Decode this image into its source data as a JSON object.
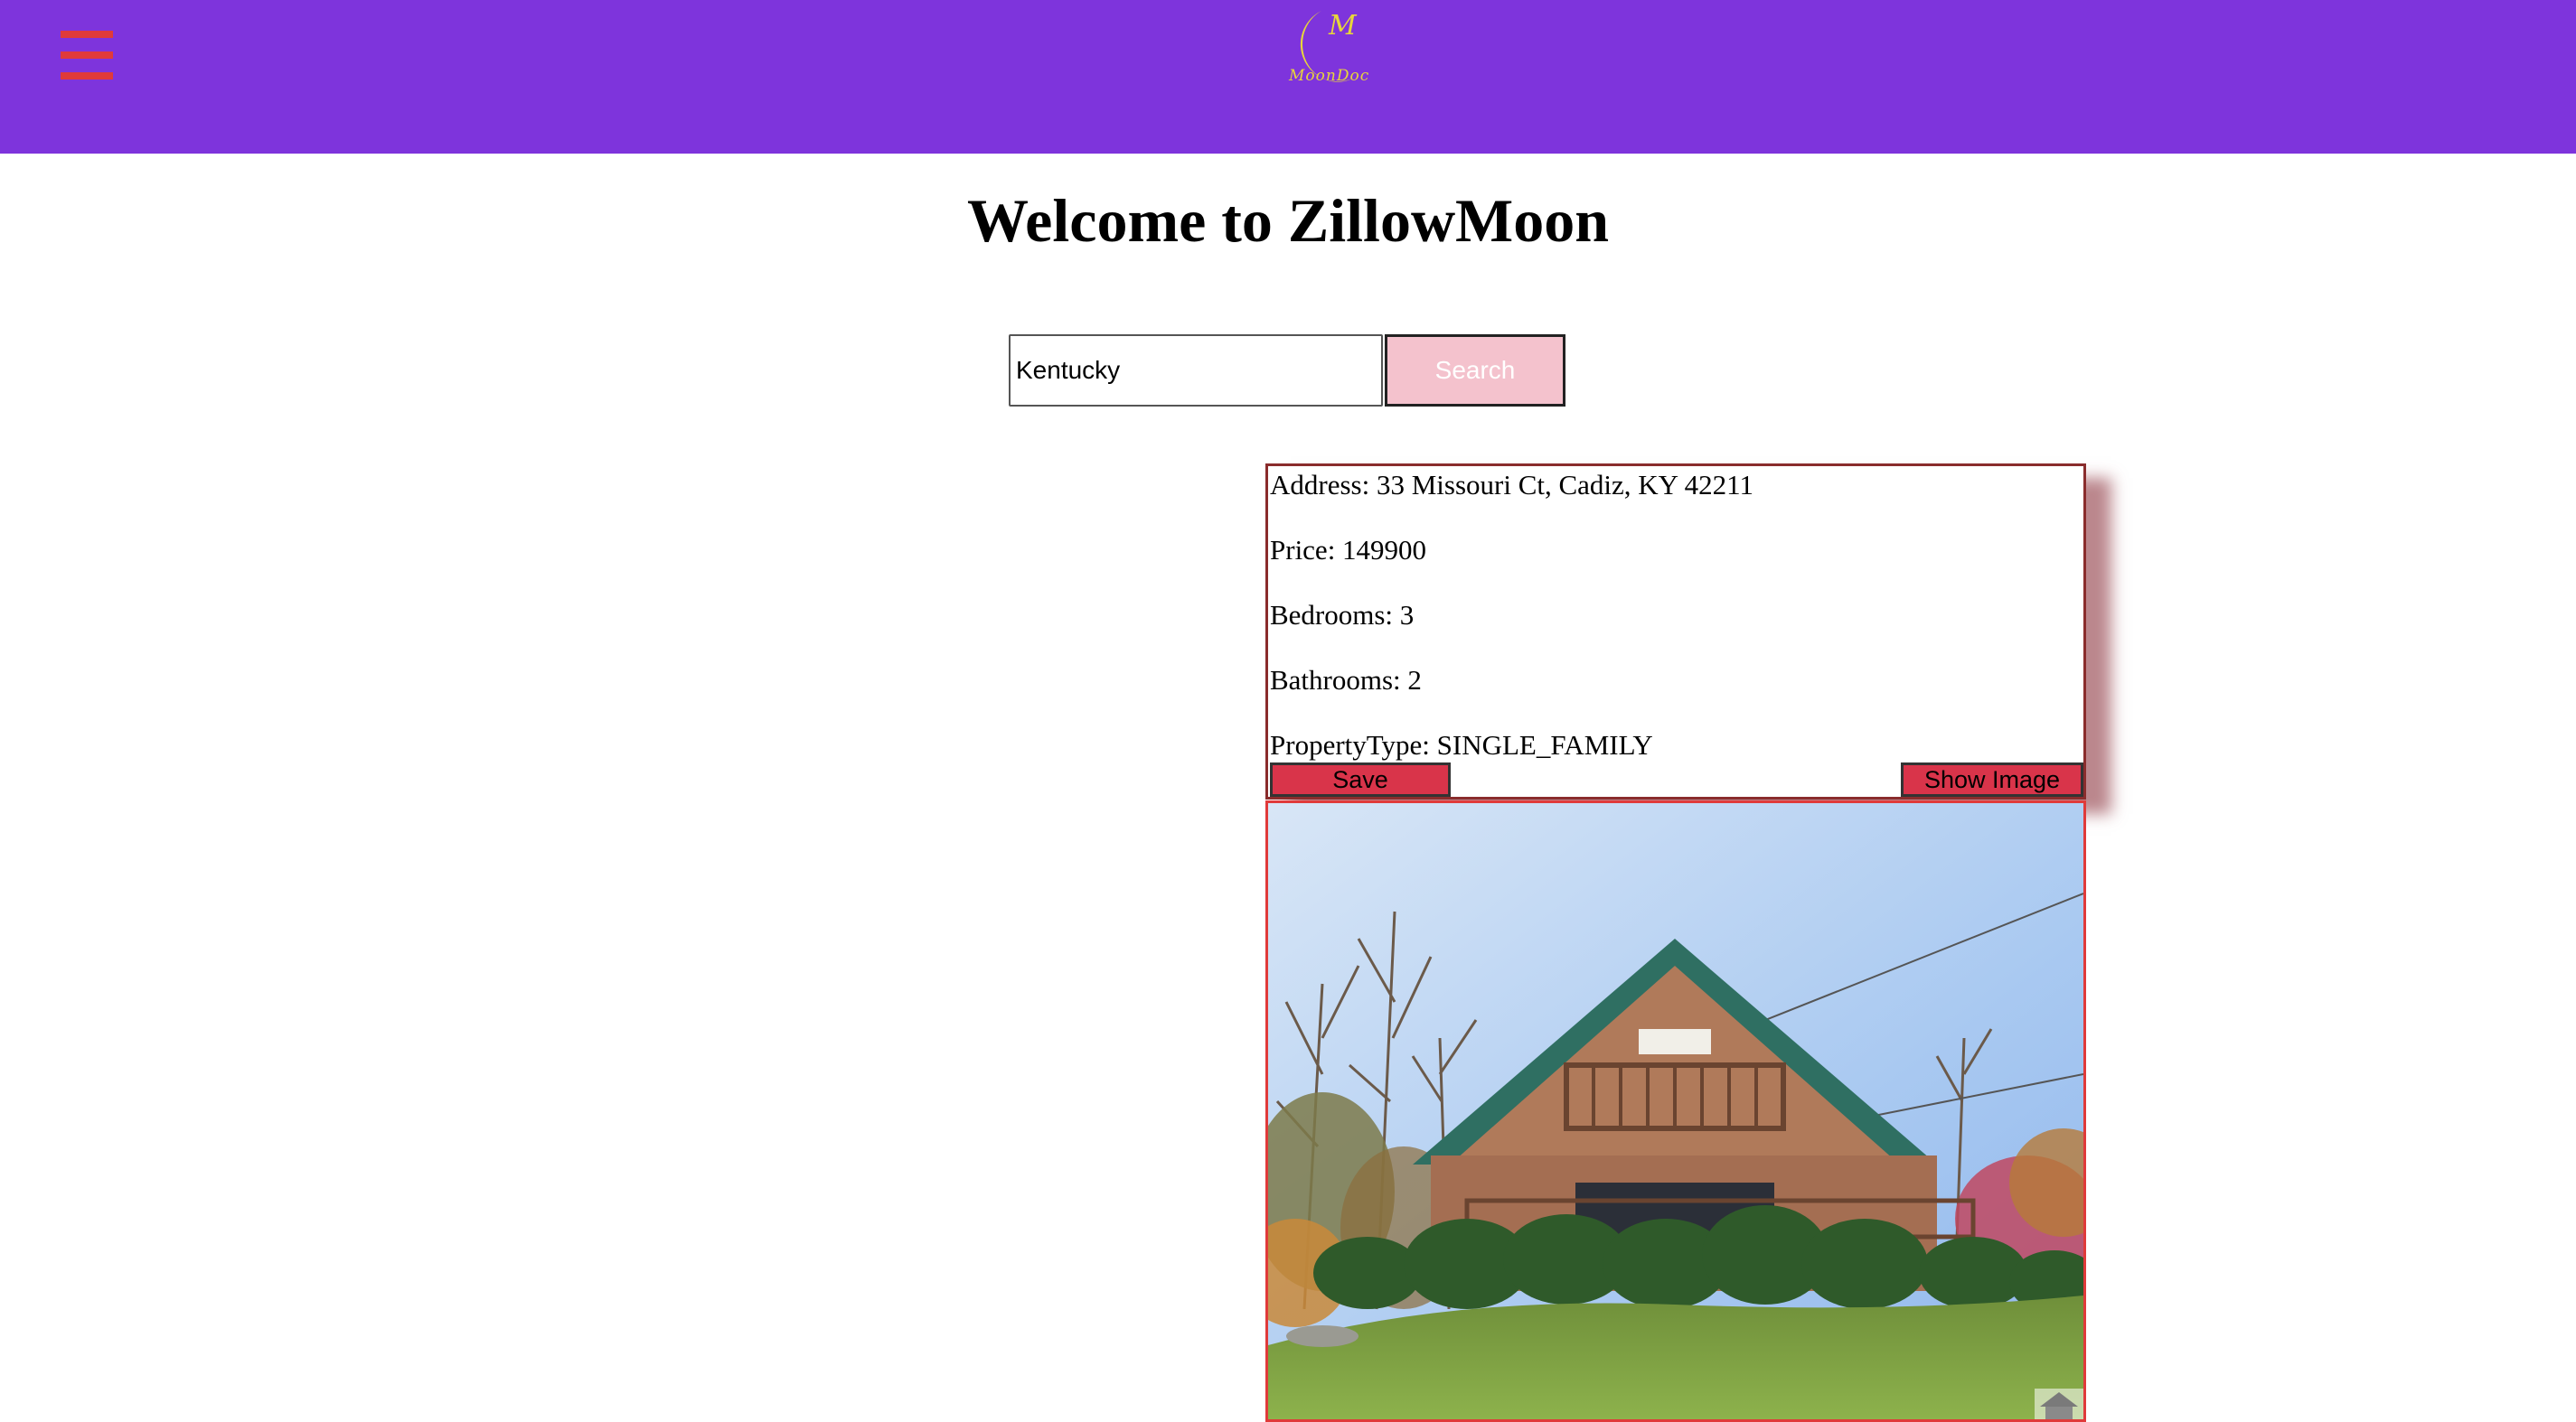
{
  "header": {
    "menu_icon": "hamburger-menu-icon",
    "logo_letter": "M",
    "logo_text": "MoonDoc",
    "colors": {
      "bar": "#7e34dc",
      "menu": "#e03a3a",
      "logo": "#e8d63a"
    }
  },
  "main": {
    "title": "Welcome to ZillowMoon",
    "search": {
      "value": "Kentucky",
      "button_label": "Search"
    }
  },
  "listing": {
    "address": "Address: 33 Missouri Ct, Cadiz, KY 42211",
    "price": "Price: 149900",
    "bedrooms": "Bedrooms: 3",
    "bathrooms": "Bathrooms: 2",
    "property_type": "PropertyType: SINGLE_FAMILY",
    "save_label": "Save",
    "show_image_label": "Show Image",
    "photo_icon": "house-photo",
    "corner_icon": "home-icon"
  }
}
